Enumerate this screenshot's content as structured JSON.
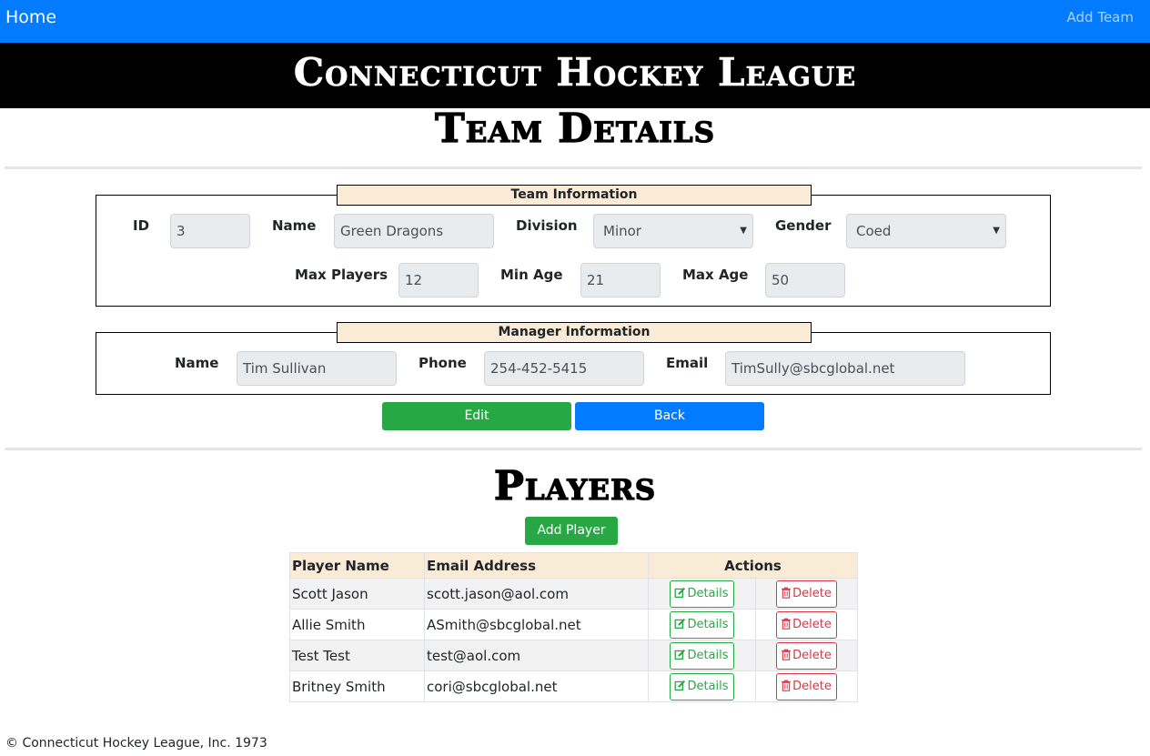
{
  "nav": {
    "home_label": "Home",
    "add_team_label": "Add Team"
  },
  "banner": {
    "title": "Connecticut Hockey League"
  },
  "team_details_title": "Team Details",
  "team_info": {
    "legend": "Team Information",
    "id_label": "ID",
    "id_value": "3",
    "name_label": "Name",
    "name_value": "Green Dragons",
    "division_label": "Division",
    "division_value": "Minor",
    "gender_label": "Gender",
    "gender_value": "Coed",
    "max_players_label": "Max Players",
    "max_players_value": "12",
    "min_age_label": "Min Age",
    "min_age_value": "21",
    "max_age_label": "Max Age",
    "max_age_value": "50"
  },
  "manager_info": {
    "legend": "Manager Information",
    "name_label": "Name",
    "name_value": "Tim Sullivan",
    "phone_label": "Phone",
    "phone_value": "254-452-5415",
    "email_label": "Email",
    "email_value": "TimSully@sbcglobal.net"
  },
  "buttons": {
    "edit_label": "Edit",
    "back_label": "Back",
    "add_player_label": "Add Player"
  },
  "players_title": "Players",
  "players_table": {
    "headers": [
      "Player Name",
      "Email Address",
      "Actions"
    ],
    "details_label": "Details",
    "delete_label": "Delete",
    "rows": [
      {
        "name": "Scott Jason",
        "email": "scott.jason@aol.com"
      },
      {
        "name": "Allie Smith",
        "email": "ASmith@sbcglobal.net"
      },
      {
        "name": "Test Test",
        "email": "test@aol.com"
      },
      {
        "name": "Britney Smith",
        "email": "cori@sbcglobal.net"
      }
    ]
  },
  "footer": {
    "text": "© Connecticut Hockey League, Inc. 1973"
  },
  "colors": {
    "navbar": "#037bfe",
    "banner": "#000000",
    "legend_bg": "#faebd7",
    "success": "#28a745",
    "danger": "#dc3545",
    "primary": "#037bfe"
  },
  "icons": {
    "details": "edit-icon",
    "delete": "trash-icon",
    "select_caret": "caret-down-icon"
  }
}
